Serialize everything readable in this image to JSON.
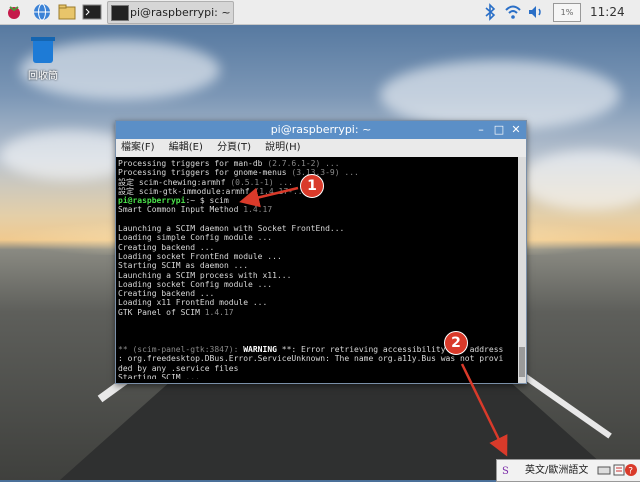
{
  "taskbar": {
    "window_button_label": "pi@raspberrypi: ~",
    "clock": "11:24",
    "icons": [
      "raspberry-menu-icon",
      "globe-browser-icon",
      "folder-icon",
      "terminal-icon",
      "bluetooth-icon",
      "wifi-icon",
      "volume-icon",
      "cpu-monitor-icon"
    ]
  },
  "desktop": {
    "trash_label": "回收筒"
  },
  "terminal_window": {
    "title": "pi@raspberrypi: ~",
    "menus": [
      "檔案(F)",
      "編輯(E)",
      "分頁(T)",
      "說明(H)"
    ],
    "lines": [
      {
        "text": "Processing triggers for man-db ",
        "dim": "(2.7.6.1-2) ..."
      },
      {
        "text": "Processing triggers for gnome-menus ",
        "dim": "(3.13.3-9) ..."
      },
      {
        "text": "設定 scim-chewing:armhf ",
        "dim": "(0.5.1-1) ..."
      },
      {
        "text": "設定 scim-gtk-immodule:armhf ",
        "dim": "(1.4.17-..."
      },
      {
        "prompt": "pi@raspberrypi",
        "text": ":~ $ scim"
      },
      {
        "text": "Smart Common Input Method ",
        "dim": "1.4.17"
      },
      {
        "text": ""
      },
      {
        "text": "Launching a SCIM daemon with Socket FrontEnd..."
      },
      {
        "text": "Loading simple Config module ..."
      },
      {
        "text": "Creating backend ..."
      },
      {
        "text": "Loading socket FrontEnd module ..."
      },
      {
        "text": "Starting SCIM as daemon ..."
      },
      {
        "text": "Launching a SCIM process with x11..."
      },
      {
        "text": "Loading socket Config module ..."
      },
      {
        "text": "Creating backend ..."
      },
      {
        "text": "Loading x11 FrontEnd module ..."
      },
      {
        "text": "GTK Panel of SCIM ",
        "dim": "1.4.17"
      },
      {
        "text": ""
      },
      {
        "text": ""
      },
      {
        "text": ""
      },
      {
        "dim": "** (scim-panel-gtk:3847): ",
        "warn": "WARNING",
        "text": " **: Error retrieving accessibility bus address"
      },
      {
        "text": ": org.freedesktop.DBus.Error.ServiceUnknown: The name org.a11y.Bus was not provi"
      },
      {
        "text": "ded by any .service files"
      },
      {
        "text": "Starting SCIM ..."
      }
    ]
  },
  "annotations": {
    "marker1": "1",
    "marker2": "2"
  },
  "ime_panel": {
    "language_label": "英文/歐洲語文",
    "icons": [
      "scim-logo-icon",
      "keyboard-icon",
      "settings-icon",
      "help-icon"
    ]
  },
  "colors": {
    "title_bar": "#5b8fc7",
    "marker": "#d93a2a",
    "prompt_green": "#4ae04a"
  }
}
